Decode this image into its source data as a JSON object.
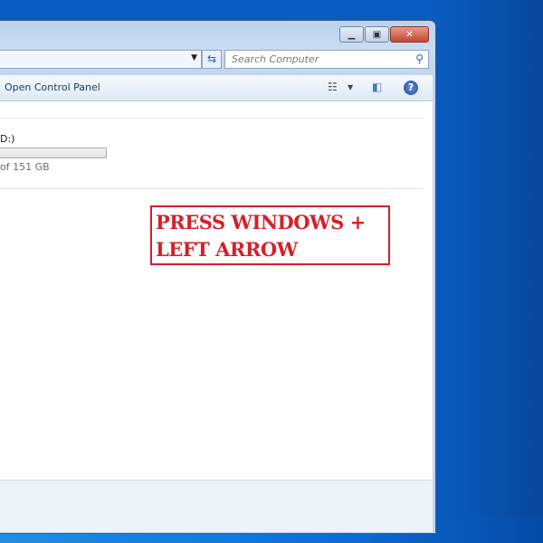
{
  "window": {
    "caption_buttons": {
      "minimize": "minimize-icon",
      "maximize": "maximize-icon",
      "close": "close-icon"
    },
    "address_bar": {
      "value": ""
    },
    "search": {
      "placeholder": "Search Computer"
    },
    "toolbar": {
      "open_control_panel": "Open Control Panel"
    },
    "drive": {
      "name": "D:)",
      "size": "of 151 GB",
      "usage_fraction": 0.0
    }
  },
  "annotation": {
    "line1": "PRESS WINDOWS +",
    "line2": "LEFT ARROW",
    "color": "#d4202a"
  }
}
